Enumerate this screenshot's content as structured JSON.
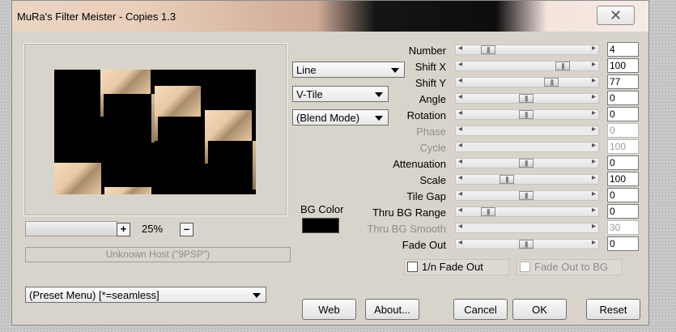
{
  "window": {
    "title": "MuRa's Filter Meister - Copies 1.3",
    "close_label": "✕"
  },
  "preview": {
    "zoom": "25%",
    "zoom_in": "+",
    "zoom_out": "–",
    "host": "Unknown Host (\"9PSP\")"
  },
  "modes": {
    "mode1": "Line",
    "mode2": "V-Tile",
    "mode3": "(Blend Mode)"
  },
  "bg": {
    "label": "BG Color",
    "color": "#000000"
  },
  "params": [
    {
      "label": "Number",
      "value": "4",
      "position": 0.15,
      "enabled": true
    },
    {
      "label": "Shift X",
      "value": "100",
      "position": 0.82,
      "enabled": true
    },
    {
      "label": "Shift Y",
      "value": "77",
      "position": 0.72,
      "enabled": true
    },
    {
      "label": "Angle",
      "value": "0",
      "position": 0.49,
      "enabled": true
    },
    {
      "label": "Rotation",
      "value": "0",
      "position": 0.49,
      "enabled": true
    },
    {
      "label": "Phase",
      "value": "0",
      "position": 0.5,
      "enabled": false
    },
    {
      "label": "Cycle",
      "value": "100",
      "position": 0.5,
      "enabled": false
    },
    {
      "label": "Attenuation",
      "value": "0",
      "position": 0.49,
      "enabled": true
    },
    {
      "label": "Scale",
      "value": "100",
      "position": 0.32,
      "enabled": true
    },
    {
      "label": "Tile Gap",
      "value": "0",
      "position": 0.49,
      "enabled": true
    },
    {
      "label": "Thru BG Range",
      "value": "0",
      "position": 0.15,
      "enabled": true
    },
    {
      "label": "Thru BG Smooth",
      "value": "30",
      "position": 0.5,
      "enabled": false
    },
    {
      "label": "Fade Out",
      "value": "0",
      "position": 0.49,
      "enabled": true
    }
  ],
  "checks": {
    "fade_1n": "1/n Fade Out",
    "fade_bg": "Fade Out to BG"
  },
  "preset": {
    "label": "(Preset Menu)  [*=seamless]"
  },
  "buttons": {
    "web": "Web",
    "about": "About...",
    "cancel": "Cancel",
    "ok": "OK",
    "reset": "Reset"
  }
}
